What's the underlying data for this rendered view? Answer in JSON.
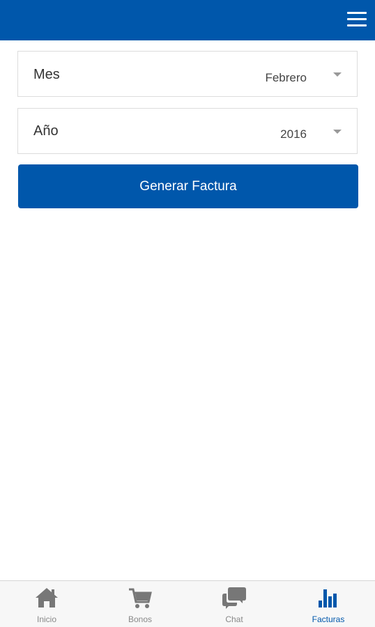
{
  "header": {
    "menu_icon": "hamburger-menu-icon",
    "color": "#0057ab"
  },
  "form": {
    "mes_label": "Mes",
    "mes_value": "Febrero",
    "ano_label": "Año",
    "ano_value": "2016",
    "submit_label": "Generar Factura"
  },
  "tabbar": {
    "tabs": [
      {
        "label": "Inicio",
        "icon": "home-icon",
        "active": false
      },
      {
        "label": "Bonos",
        "icon": "cart-icon",
        "active": false
      },
      {
        "label": "Chat",
        "icon": "chat-bubbles-icon",
        "active": false
      },
      {
        "label": "Facturas",
        "icon": "bar-chart-icon",
        "active": true
      }
    ],
    "active_color": "#0057ab",
    "inactive_color": "#888888"
  }
}
